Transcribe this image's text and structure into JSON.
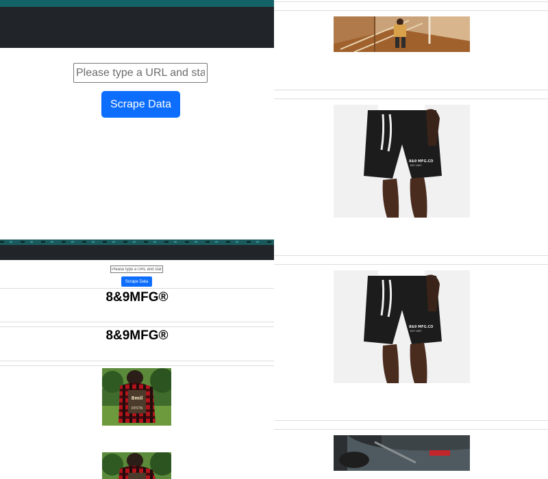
{
  "scraper": {
    "url_placeholder": "Please type a URL and start",
    "scrape_button_label": "Scrape Data"
  },
  "results": {
    "brand_headings": [
      "8&9MFG®",
      "8&9MFG®"
    ]
  },
  "shorts_print": {
    "line1": "8&9 MFG.CO",
    "line2": "EST 1997"
  },
  "colors": {
    "navbar": "#212529",
    "accent_strip": "#136366",
    "primary_button": "#0d6efd"
  }
}
